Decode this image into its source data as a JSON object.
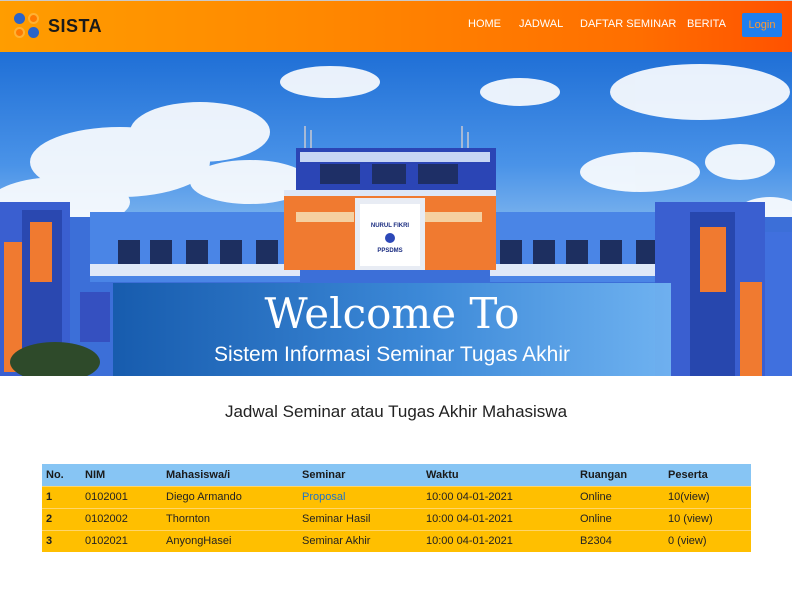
{
  "brand": {
    "name": "SISTA",
    "logo_icon": "four-dots-logo-icon"
  },
  "nav": {
    "home": "HOME",
    "jadwal": "JADWAL",
    "daftar": "DAFTAR SEMINAR",
    "berita": "BERITA",
    "login": "Login"
  },
  "hero": {
    "title": "Welcome To",
    "subtitle": "Sistem Informasi Seminar Tugas Akhir",
    "sign_line1": "NURUL FIKRI",
    "sign_line2": "PPSDMS"
  },
  "section": {
    "title": "Jadwal Seminar atau Tugas Akhir Mahasiswa"
  },
  "table": {
    "headers": [
      "No.",
      "NIM",
      "Mahasiswa/i",
      "Seminar",
      "Waktu",
      "Ruangan",
      "Peserta"
    ],
    "rows": [
      [
        "1",
        "0102001",
        "Diego Armando",
        "Proposal",
        "10:00 04-01-2021",
        "Online",
        "10(view)"
      ],
      [
        "2",
        "0102002",
        "Thornton",
        "Seminar Hasil",
        "10:00 04-01-2021",
        "Online",
        "10 (view)"
      ],
      [
        "3",
        "0102021",
        "AnyongHasei",
        "Seminar Akhir",
        "10:00 04-01-2021",
        "B2304",
        "0 (view)"
      ]
    ]
  },
  "colors": {
    "navbar_orange": "#ff8800",
    "login_blue": "#1f7ff0",
    "table_header": "#87c5f4",
    "table_row": "#ffbf00",
    "link": "#1e74c8"
  }
}
